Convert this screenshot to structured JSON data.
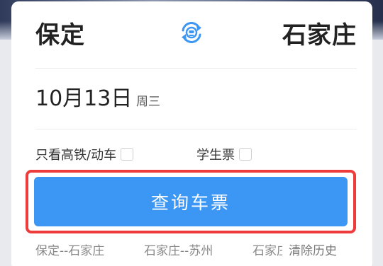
{
  "route": {
    "from_station": "保定",
    "to_station": "石家庄",
    "swap_icon": "railway-swap-icon",
    "accent_color": "#3c96f3"
  },
  "date": {
    "date_text": "10月13日",
    "weekday": "周三"
  },
  "options": {
    "high_speed_label": "只看高铁/动车",
    "high_speed_checked": false,
    "student_label": "学生票",
    "student_checked": false
  },
  "query": {
    "button_label": "查询车票",
    "button_color": "#3c96f3",
    "highlight_color": "#ee3b3b"
  },
  "history": {
    "items": [
      "保定--石家庄",
      "石家庄--苏州",
      "石家庄--"
    ],
    "clear_label": "清除历史"
  }
}
